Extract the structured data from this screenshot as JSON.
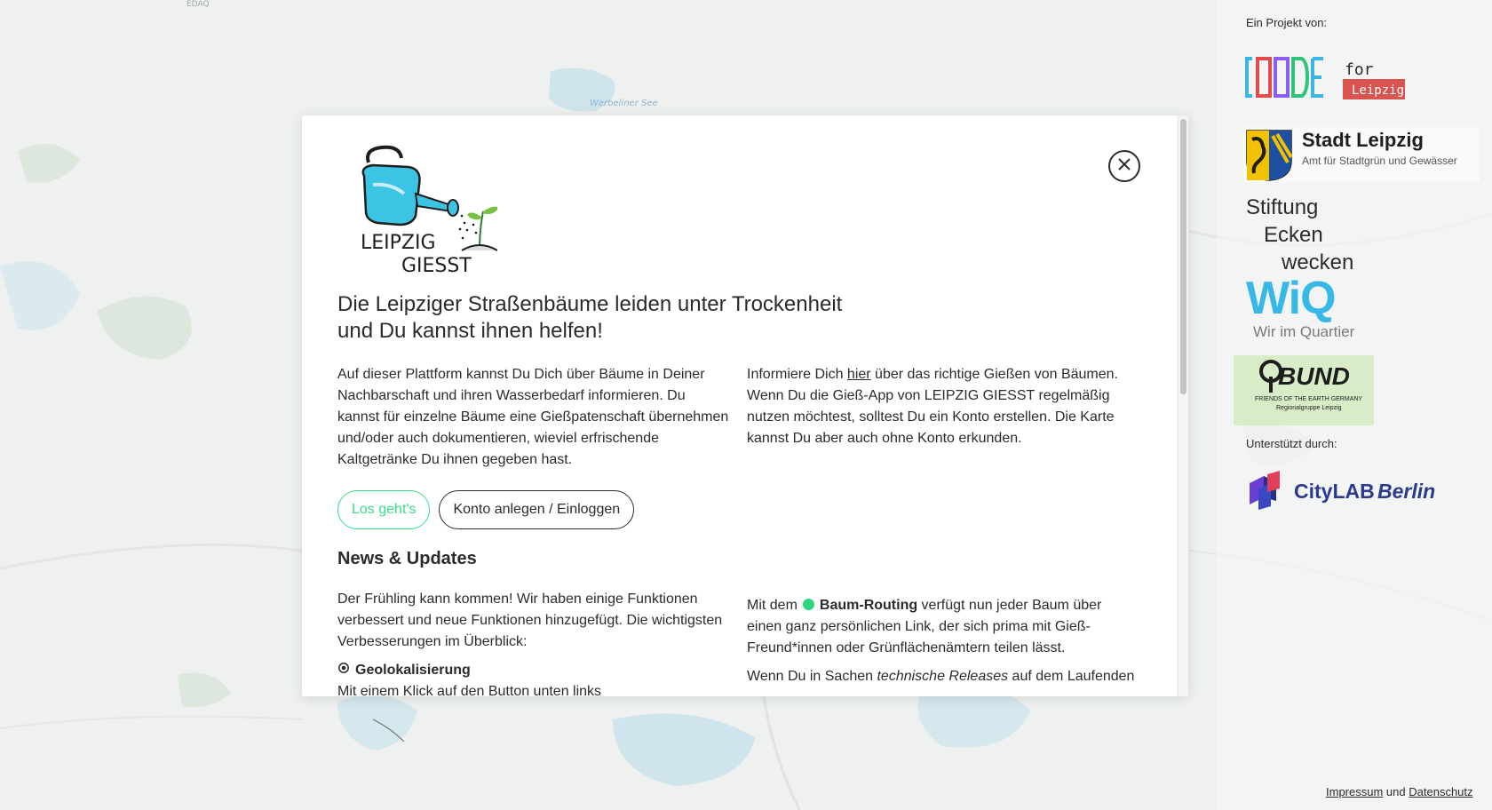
{
  "map": {
    "labels": [
      "EDAQ",
      "Werbeliner See"
    ]
  },
  "modal": {
    "logo_text_line1": "LEIPZIG",
    "logo_text_line2": "GIESST",
    "headline_line1": "Die Leipziger Straßenbäume leiden unter Trockenheit",
    "headline_line2": "und Du kannst ihnen helfen!",
    "intro_left": "Auf dieser Plattform kannst Du Dich über Bäume in Deiner Nachbarschaft und ihren Wasserbedarf informieren. Du kannst für einzelne Bäume eine Gießpatenschaft übernehmen und/oder auch dokumentieren, wieviel erfrischende Kaltgetränke Du ihnen gegeben hast.",
    "intro_right_prefix": "Informiere Dich ",
    "intro_right_link": "hier",
    "intro_right_suffix": " über das richtige Gießen von Bäumen. Wenn Du die Gieß-App von LEIPZIG GIESST regelmäßig nutzen möchtest, solltest Du ein Konto erstellen. Die Karte kannst Du aber auch ohne Konto erkunden.",
    "btn_start": "Los geht's",
    "btn_account": "Konto anlegen / Einloggen",
    "news_title": "News & Updates",
    "news_left": "Der Frühling kann kommen! Wir haben einige Funktionen verbessert und neue Funktionen hinzugefügt. Die wichtigsten Verbesserungen im Überblick:",
    "feature_title": "Geolokalisierung",
    "feature_sub": "Mit einem Klick auf den Button unten links",
    "news_right_prefix": "Mit dem",
    "news_right_bold": "Baum-Routing",
    "news_right_suffix": " verfügt nun jeder Baum über einen ganz persönlichen Link, der sich prima mit Gieß-Freund*innen oder Grünflächenämtern teilen lässt.",
    "news_right2_prefix": "Wenn Du in Sachen ",
    "news_right2_italic": "technische Releases",
    "news_right2_suffix": " auf dem Laufenden",
    "colors": {
      "accent": "#37de8a",
      "dot": "#2fd57c"
    }
  },
  "sidebar": {
    "project_label": "Ein Projekt von:",
    "codefor_text": "for",
    "codefor_city": "Leipzig",
    "stadt_title": "Stadt Leipzig",
    "stadt_sub": "Amt für Stadtgrün und Gewässer",
    "stiftung_l1": "Stiftung",
    "stiftung_l2": "Ecken",
    "stiftung_l3": "wecken",
    "wiq_text": "WiQ",
    "wiq_sub": "Wir im Quartier",
    "bund_title": "BUND",
    "bund_sub1": "FRIENDS OF THE EARTH GERMANY",
    "bund_sub2": "Regionalgruppe Leipzig",
    "supported_label": "Unterstützt durch:",
    "citylab_1": "CityLAB",
    "citylab_2": "Berlin"
  },
  "footer": {
    "impressum": "Impressum",
    "und": "und",
    "datenschutz": "Datenschutz"
  }
}
